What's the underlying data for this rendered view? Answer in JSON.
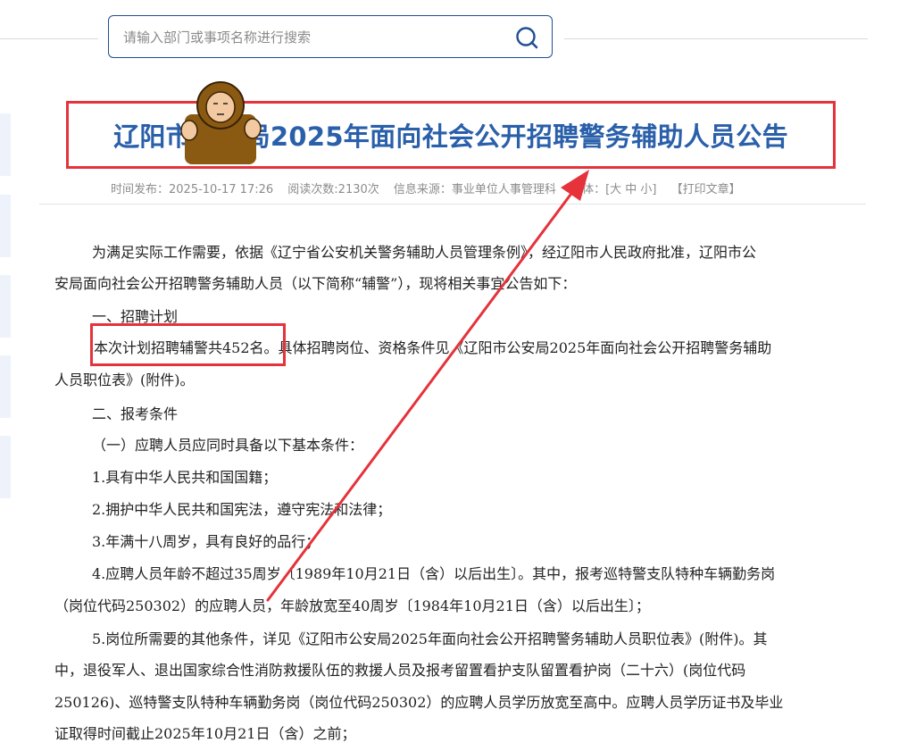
{
  "search": {
    "placeholder": "请输入部门或事项名称进行搜索"
  },
  "article": {
    "title": "辽阳市公安局2025年面向社会公开招聘警务辅助人员公告",
    "meta": {
      "time": "时间发布：2025-10-17 17:26",
      "reads": "阅读次数:2130次",
      "source": "信息来源：事业单位人事管理科",
      "font": "字体：[大 中 小]",
      "print": "【打印文章】"
    },
    "lines": [
      "为满足实际工作需要，依据《辽宁省公安机关警务辅助人员管理条例》，经辽阳市人民政府批准，辽阳市公",
      "安局面向社会公开招聘警务辅助人员（以下简称“辅警”），现将相关事宜公告如下：",
      "一、招聘计划",
      "本次计划招聘辅警共452名。具体招聘岗位、资格条件见《辽阳市公安局2025年面向社会公开招聘警务辅助",
      "人员职位表》(附件)。",
      "二、报考条件",
      "（一）应聘人员应同时具备以下基本条件：",
      "1.具有中华人民共和国国籍；",
      "2.拥护中华人民共和国宪法，遵守宪法和法律；",
      "3.年满十八周岁，具有良好的品行；",
      "4.应聘人员年龄不超过35周岁〔1989年10月21日（含）以后出生〕。其中，报考巡特警支队特种车辆勤务岗",
      "（岗位代码250302）的应聘人员，年龄放宽至40周岁〔1984年10月21日（含）以后出生〕；",
      "5.岗位所需要的其他条件，详见《辽阳市公安局2025年面向社会公开招聘警务辅助人员职位表》(附件)。其",
      "中，退役军人、退出国家综合性消防救援队伍的救援人员及报考留置看护支队留置看护岗（二十六）(岗位代码",
      "250126)、巡特警支队特种车辆勤务岗（岗位代码250302）的应聘人员学历放宽至高中。应聘人员学历证书及毕业",
      "证取得时间截止2025年10月21日（含）之前；"
    ]
  },
  "colors": {
    "accent": "#2a5faa",
    "highlight": "#e5323b"
  }
}
